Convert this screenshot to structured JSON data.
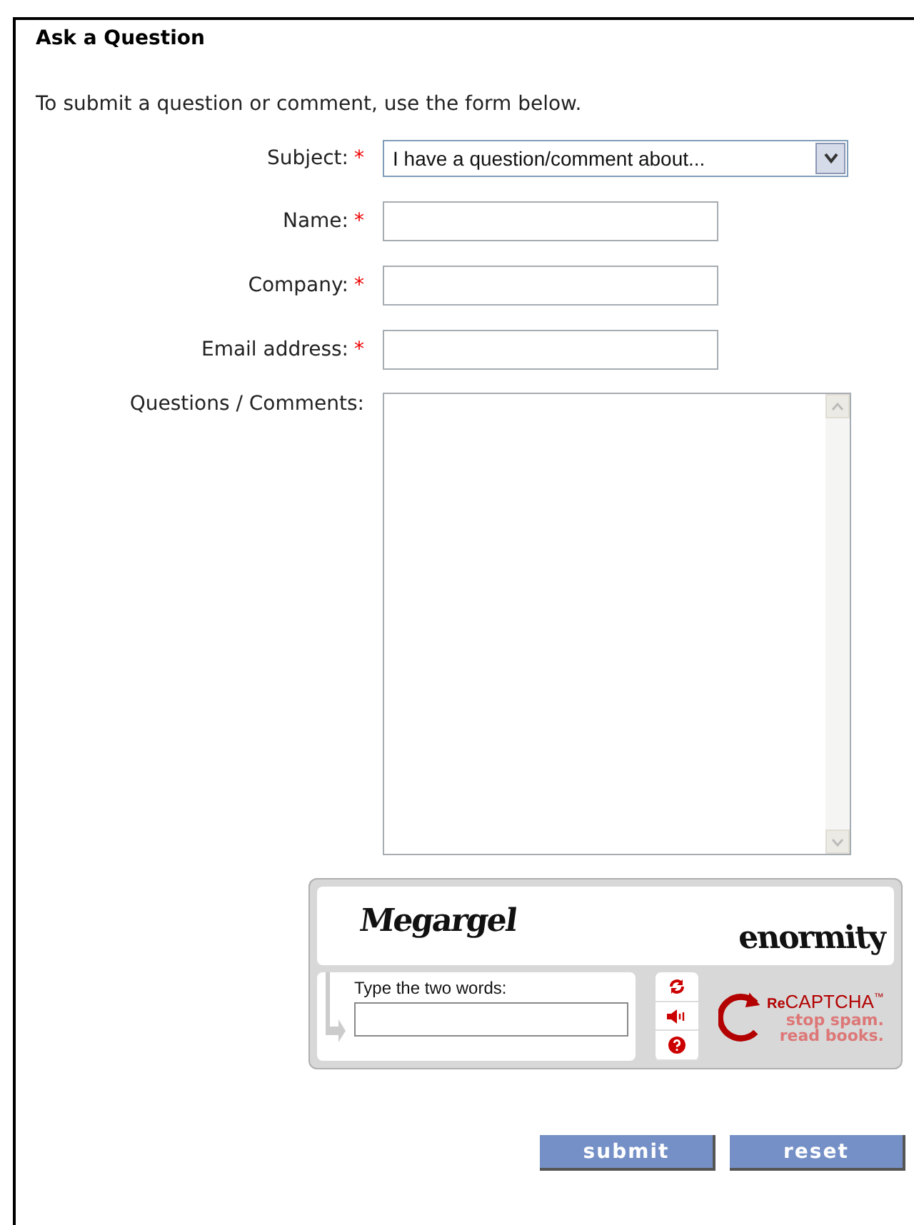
{
  "title": "Ask a Question",
  "intro": "To submit a question or comment, use the form below.",
  "fields": [
    {
      "label": "Subject:",
      "required_mark": "*",
      "kind": "select",
      "value": "I have a question/comment about..."
    },
    {
      "label": "Name:",
      "required_mark": "*",
      "kind": "text"
    },
    {
      "label": "Company:",
      "required_mark": "*",
      "kind": "text"
    },
    {
      "label": "Email address:",
      "required_mark": "*",
      "kind": "text"
    },
    {
      "label": "Questions / Comments:",
      "kind": "textarea"
    }
  ],
  "captcha": {
    "words": [
      "Megargel",
      "enormity"
    ],
    "prompt": "Type the two words:",
    "brand_prefix": "Re",
    "brand": "CAPTCHA",
    "trademark": "™",
    "slogan": [
      "stop spam.",
      "read books."
    ]
  },
  "buttons": [
    "submit",
    "reset"
  ]
}
